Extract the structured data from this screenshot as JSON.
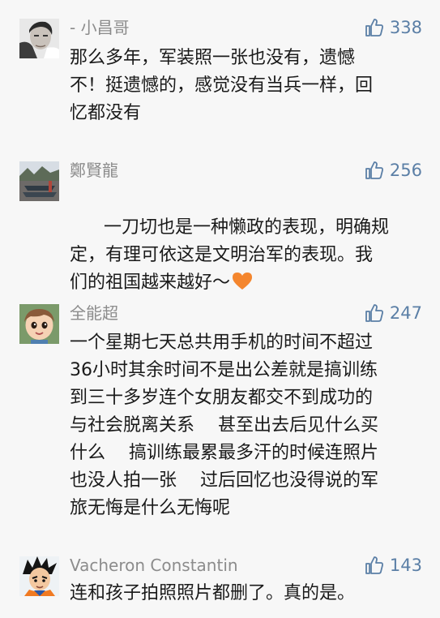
{
  "comments": [
    {
      "username": "- 小昌哥",
      "likes": "338",
      "avatar_icon": "man-portrait-avatar",
      "text": "那么多年，军装照一张也没有，遗憾\n不！挺遗憾的，感觉没有当兵一样，回\n忆都没有"
    },
    {
      "username": "鄭賢龍",
      "likes": "256",
      "avatar_icon": "street-photo-avatar",
      "text": "一刀切也是一种懒政的表现，明确规\n定，有理可依这是文明治军的表现。我\n们的祖国越来越好～",
      "emoji": "orange-heart-emoji"
    },
    {
      "username": "全能超",
      "likes": "247",
      "avatar_icon": "cartoon-child-avatar",
      "text": "一个星期七天总共用手机的时间不超过\n36小时其余时间不是出公差就是搞训练\n到三十多岁连个女朋友都交不到成功的\n与社会脱离关系　 甚至出去后见什么买\n什么　 搞训练最累最多汗的时候连照片\n也没人拍一张　 过后回忆也没得说的军\n旅无悔是什么无悔呢"
    },
    {
      "username": "Vacheron Constantin",
      "likes": "143",
      "avatar_icon": "anime-character-avatar",
      "text": "连和孩子拍照照片都删了。真的是。"
    }
  ],
  "colors": {
    "background": "#f7f7f7",
    "username": "#8c8c8c",
    "like": "#5b7fa6",
    "text": "#1a1a1a"
  }
}
